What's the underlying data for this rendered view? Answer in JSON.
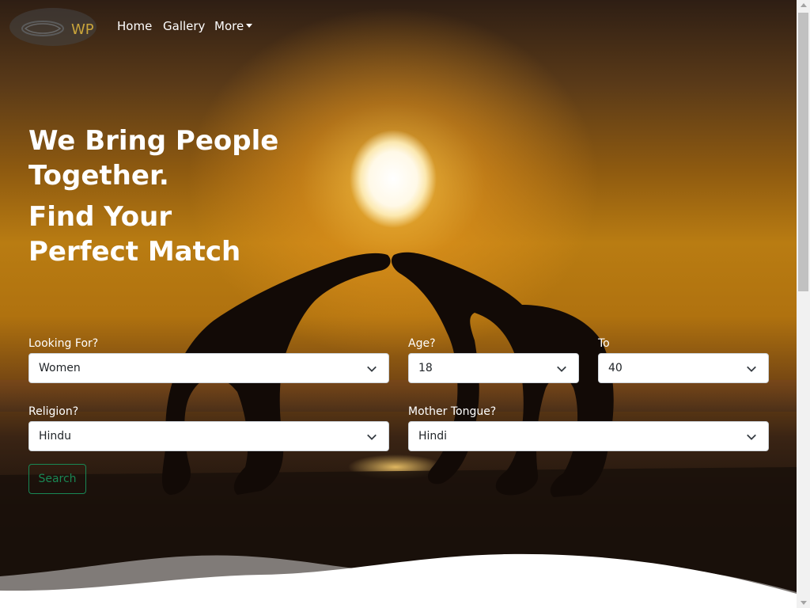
{
  "navbar": {
    "brand_text": "WP",
    "links": [
      {
        "label": "Home"
      },
      {
        "label": "Gallery"
      },
      {
        "label": "More"
      }
    ]
  },
  "hero": {
    "headline_1_line_1": "We Bring People",
    "headline_1_line_2": "Together.",
    "headline_2_line_1": "Find Your",
    "headline_2_line_2": "Perfect Match"
  },
  "search_form": {
    "looking_for": {
      "label": "Looking For?",
      "value": "Women"
    },
    "age_from": {
      "label": "Age?",
      "value": "18"
    },
    "age_to": {
      "label": "To",
      "value": "40"
    },
    "religion": {
      "label": "Religion?",
      "value": "Hindu"
    },
    "mother_tongue": {
      "label": "Mother Tongue?",
      "value": "Hindi"
    },
    "search_button": "Search"
  },
  "colors": {
    "search_button": "#198754",
    "brand_text": "#c9a43a"
  }
}
